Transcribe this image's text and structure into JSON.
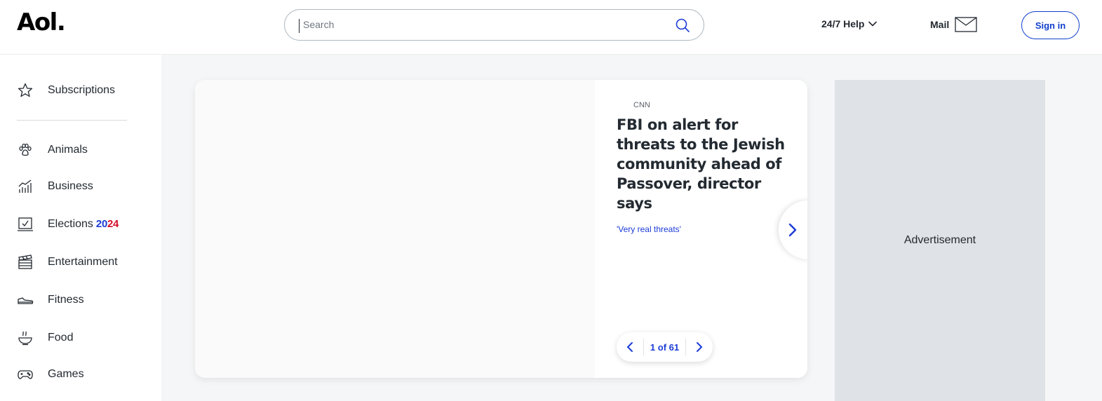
{
  "header": {
    "logo": "Aol.",
    "search_placeholder": "Search",
    "help_label": "24/7 Help",
    "mail_label": "Mail",
    "signin_label": "Sign in"
  },
  "sidebar": {
    "items": [
      {
        "label": "Subscriptions",
        "icon": "star-icon"
      },
      {
        "label": "Animals",
        "icon": "paw-icon"
      },
      {
        "label": "Business",
        "icon": "chart-icon"
      },
      {
        "label": "Elections",
        "icon": "ballot-icon",
        "year_part1": "20",
        "year_part2": "24"
      },
      {
        "label": "Entertainment",
        "icon": "clapperboard-icon"
      },
      {
        "label": "Fitness",
        "icon": "sneaker-icon"
      },
      {
        "label": "Food",
        "icon": "bowl-icon"
      },
      {
        "label": "Games",
        "icon": "gamepad-icon"
      }
    ]
  },
  "story": {
    "source": "CNN",
    "headline": "FBI on alert for threats to the Jewish community ahead of Passover, director says",
    "subhead": "'Very real threats'",
    "pager_text": "1 of 61"
  },
  "ad": {
    "label": "Advertisement"
  },
  "colors": {
    "accent_blue": "#1b3bd6",
    "accent_red": "#d40f2b",
    "signin_blue": "#0f3fcc",
    "ad_bg": "#dfe2e6"
  }
}
